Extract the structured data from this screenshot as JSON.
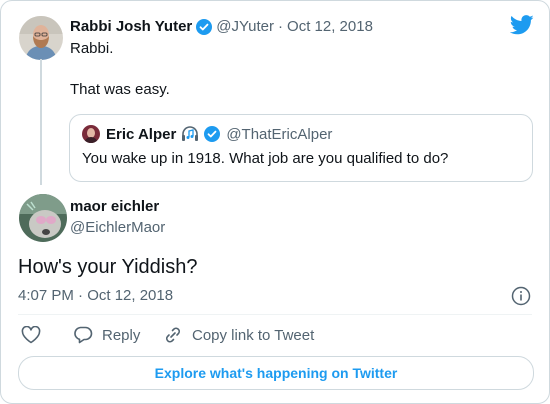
{
  "brand": {
    "accent": "#1d9bf0",
    "icon": "twitter-bird-icon"
  },
  "parent": {
    "name": "Rabbi Josh Yuter",
    "handle": "@JYuter",
    "sep": "·",
    "date": "Oct 12, 2018",
    "line1": "Rabbi.",
    "line2": "That was easy."
  },
  "quoted": {
    "name": "Eric Alper",
    "handle": "@ThatEricAlper",
    "text": "You wake up in 1918. What job are you qualified to do?"
  },
  "tweet": {
    "name": "maor eichler",
    "handle": "@EichlerMaor",
    "text": "How's your Yiddish?",
    "timestamp": "4:07 PM · Oct 12, 2018"
  },
  "actions": {
    "reply_label": "Reply",
    "copy_label": "Copy link to Tweet"
  },
  "footer": {
    "explore_label": "Explore what's happening on Twitter"
  }
}
